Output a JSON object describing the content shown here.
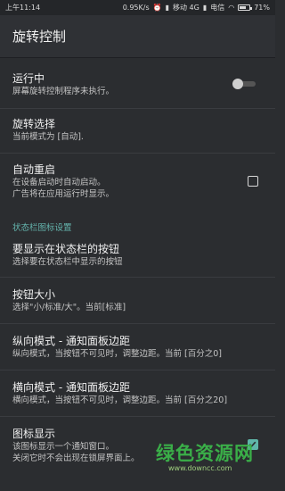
{
  "status_bar": {
    "time": "上午11:14",
    "speed": "0.95K/s",
    "carrier1": "移动 4G",
    "carrier2": "电信",
    "battery": "71%",
    "battery_level": 0.71
  },
  "toolbar": {
    "title": "旋转控制"
  },
  "prefs": {
    "running": {
      "title": "运行中",
      "summary": "屏幕旋转控制程序未执行。",
      "enabled": false
    },
    "rotation_select": {
      "title": "旋转选择",
      "summary": "当前模式为 [自动]."
    },
    "auto_restart": {
      "title": "自动重启",
      "summary_line1": "在设备启动时自动启动。",
      "summary_line2": "广告将在应用运行时显示。",
      "checked": false
    },
    "section_header": "状态栏图标设置",
    "status_buttons": {
      "title": "要显示在状态栏的按钮",
      "summary": "选择要在状态栏中显示的按钮"
    },
    "button_size": {
      "title": "按钮大小",
      "summary": "选择\"小/标准/大\"。当前[标准]"
    },
    "portrait_margin": {
      "title": "纵向模式 - 通知面板边距",
      "summary": "纵向模式，当按钮不可见时，调整边距。当前 [百分之0]"
    },
    "landscape_margin": {
      "title": "横向模式 - 通知面板边距",
      "summary": "横向模式，当按钮不可见时，调整边距。当前 [百分之20]"
    },
    "icon_display": {
      "title": "图标显示",
      "summary_line1": "该图标显示一个通知窗口。",
      "summary_line2": "关闭它时不会出现在锁屏界面上。",
      "checked": true
    }
  },
  "watermark": {
    "logo": "绿色资源网",
    "url": "www.downcc.com"
  }
}
